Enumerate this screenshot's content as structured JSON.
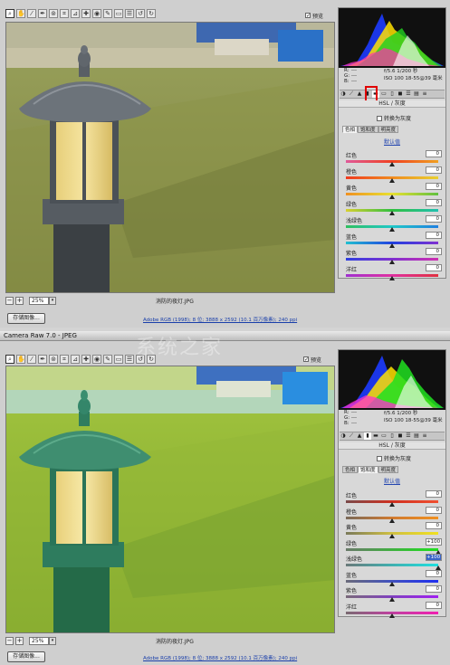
{
  "top": {
    "preview_label": "预览",
    "zoom": "25%",
    "filename": "消防的夜灯.JPG",
    "save_label": "存储图像...",
    "workflow": "Adobe RGB (1998); 8 位; 3888 x 2592 (10.1 百万像素); 240 ppi",
    "info": {
      "r": "R:",
      "g": "G:",
      "b": "B:",
      "dash": "---",
      "exif1": "f/5.6   1/200 秒",
      "exif2": "ISO 100   18-55@39 毫米"
    },
    "section_title": "HSL / 灰度",
    "grayscale": "转换为灰度",
    "subtabs": [
      "色相",
      "饱和度",
      "明亮度"
    ],
    "active_subtab": 0,
    "default": "默认值",
    "sliders": [
      {
        "label": "红色",
        "value": "0",
        "pos": 0.5,
        "track": [
          "#e05a9a",
          "#f04020",
          "#f0a020"
        ]
      },
      {
        "label": "橙色",
        "value": "0",
        "pos": 0.5,
        "track": [
          "#f03a20",
          "#f08a20",
          "#e8d030"
        ]
      },
      {
        "label": "黄色",
        "value": "0",
        "pos": 0.5,
        "track": [
          "#f09020",
          "#e8e030",
          "#60c040"
        ]
      },
      {
        "label": "绿色",
        "value": "0",
        "pos": 0.5,
        "track": [
          "#d8d030",
          "#30c040",
          "#20c0b0"
        ]
      },
      {
        "label": "浅绿色",
        "value": "0",
        "pos": 0.5,
        "track": [
          "#30c060",
          "#20c8c8",
          "#2080e0"
        ]
      },
      {
        "label": "蓝色",
        "value": "0",
        "pos": 0.5,
        "track": [
          "#20c0d0",
          "#2040e0",
          "#8030d0"
        ]
      },
      {
        "label": "紫色",
        "value": "0",
        "pos": 0.5,
        "track": [
          "#3040e0",
          "#8030d0",
          "#d030b0"
        ]
      },
      {
        "label": "洋红",
        "value": "0",
        "pos": 0.5,
        "track": [
          "#a030d0",
          "#e030a0",
          "#e03040"
        ]
      }
    ]
  },
  "bottom": {
    "window_title": "Camera Raw 7.0 - JPEG",
    "preview_label": "预览",
    "zoom": "25%",
    "filename": "消防的夜灯.JPG",
    "save_label": "存储图像...",
    "workflow": "Adobe RGB (1998); 8 位; 3888 x 2592 (10.1 百万像素); 240 ppi",
    "info": {
      "r": "R:",
      "g": "G:",
      "b": "B:",
      "dash": "---",
      "exif1": "f/5.6   1/200 秒",
      "exif2": "ISO 100   18-55@39 毫米"
    },
    "section_title": "HSL / 灰度",
    "grayscale": "转换为灰度",
    "subtabs": [
      "色相",
      "饱和度",
      "明亮度"
    ],
    "active_subtab": 1,
    "default": "默认值",
    "sliders": [
      {
        "label": "红色",
        "value": "0",
        "pos": 0.5,
        "track": [
          "#7a4a4a",
          "#d03020",
          "#f05030"
        ]
      },
      {
        "label": "橙色",
        "value": "0",
        "pos": 0.5,
        "track": [
          "#7a6a5a",
          "#d07a30",
          "#f09020"
        ]
      },
      {
        "label": "黄色",
        "value": "0",
        "pos": 0.5,
        "track": [
          "#7a7a5a",
          "#d0c040",
          "#f0e020"
        ]
      },
      {
        "label": "绿色",
        "value": "+100",
        "pos": 1.0,
        "track": [
          "#6a7a6a",
          "#40b040",
          "#20e020"
        ]
      },
      {
        "label": "浅绿色",
        "value": "+100",
        "pos": 1.0,
        "track": [
          "#6a7a7a",
          "#40b0b0",
          "#20e0e0"
        ]
      },
      {
        "label": "蓝色",
        "value": "0",
        "pos": 0.5,
        "track": [
          "#6a6a7a",
          "#4050c0",
          "#2030f0"
        ]
      },
      {
        "label": "紫色",
        "value": "0",
        "pos": 0.5,
        "track": [
          "#7a6a7a",
          "#8040c0",
          "#a020f0"
        ]
      },
      {
        "label": "洋红",
        "value": "0",
        "pos": 0.5,
        "track": [
          "#7a6a72",
          "#c040a0",
          "#f020b0"
        ]
      }
    ]
  },
  "watermark": "系统之家",
  "colors": {
    "highlight_red": "#e00000",
    "link_blue": "#1a3faa",
    "lamp_gray": "#5e6670",
    "lamp_green": "#2f7a5e",
    "glass": "#f0dc8a"
  }
}
